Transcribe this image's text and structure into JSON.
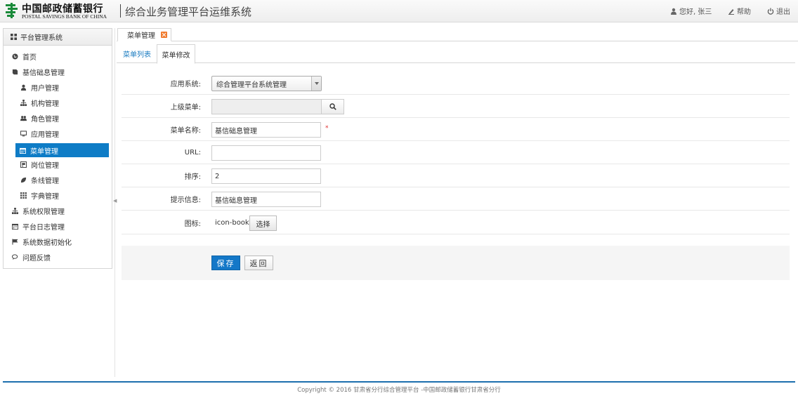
{
  "header": {
    "bank_name_cn": "中国邮政储蓄银行",
    "bank_name_en": "POSTAL SAVINGS BANK OF CHINA",
    "app_title": "综合业务管理平台运维系统",
    "user_greeting": "您好, 张三",
    "help_label": "帮助",
    "logout_label": "退出",
    "brand_color": "#1a8a3a"
  },
  "sidebar": {
    "title": "平台管理系统",
    "items": [
      {
        "label": "首页",
        "icon": "globe-icon"
      },
      {
        "label": "基信础息管理",
        "icon": "book-icon"
      },
      {
        "label": "用户管理",
        "icon": "user-icon"
      },
      {
        "label": "机构管理",
        "icon": "sitemap-icon"
      },
      {
        "label": "角色管理",
        "icon": "users-icon"
      },
      {
        "label": "应用管理",
        "icon": "desktop-icon"
      },
      {
        "label": "菜单管理",
        "icon": "calendar-icon"
      },
      {
        "label": "岗位管理",
        "icon": "stamp-icon"
      },
      {
        "label": "条线管理",
        "icon": "leaf-icon"
      },
      {
        "label": "字典管理",
        "icon": "grid-icon"
      },
      {
        "label": "系统权限管理",
        "icon": "sitemap-icon"
      },
      {
        "label": "平台日志管理",
        "icon": "calendar-icon"
      },
      {
        "label": "系统数据初始化",
        "icon": "flag-icon"
      },
      {
        "label": "问题反馈",
        "icon": "comments-icon"
      }
    ]
  },
  "tabs": {
    "open_tab": "菜单管理",
    "inner": {
      "list": "菜单列表",
      "edit": "菜单修改"
    }
  },
  "form": {
    "app_system_label": "应用系统:",
    "app_system_value": "综合管理平台系统管理",
    "parent_menu_label": "上级菜单:",
    "parent_menu_value": "",
    "menu_name_label": "菜单名称:",
    "menu_name_value": "基信础息管理",
    "required_mark": "*",
    "url_label": "URL:",
    "url_value": "",
    "order_label": "排序:",
    "order_value": "2",
    "tip_label": "提示信息:",
    "tip_value": "基信础息管理",
    "icon_label": "图标:",
    "icon_value": "icon-book",
    "choose_label": "选择"
  },
  "actions": {
    "save_label": "保存",
    "back_label": "返回"
  },
  "footer": {
    "copyright": "Copyright © 2016 甘肃省分行综合管理平台 -中国邮政储蓄银行甘肃省分行"
  }
}
